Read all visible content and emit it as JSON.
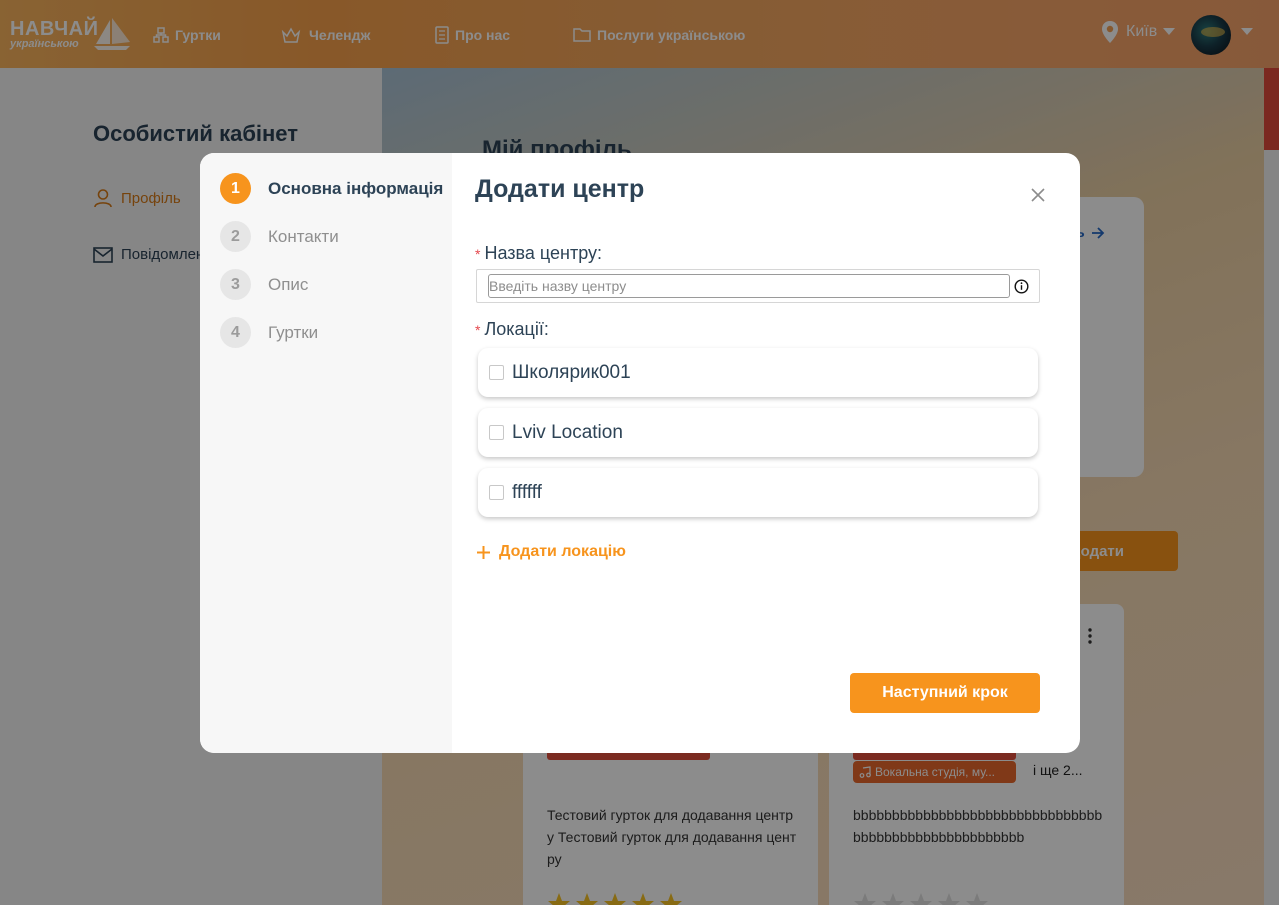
{
  "header": {
    "logo_main": "НАВЧАЙ",
    "logo_sub": "українською",
    "nav": [
      {
        "label": "Гуртки",
        "icon": "clubs-icon"
      },
      {
        "label": "Челендж",
        "icon": "challenge-icon"
      },
      {
        "label": "Про нас",
        "icon": "about-icon"
      },
      {
        "label": "Послуги українською",
        "icon": "folder-icon"
      }
    ],
    "city": "Київ"
  },
  "sidebar": {
    "title": "Особистий кабінет",
    "items": [
      {
        "label": "Профіль",
        "icon": "user-icon"
      },
      {
        "label": "Повідомлення",
        "icon": "mail-icon"
      }
    ]
  },
  "main": {
    "title": "Мій профіль",
    "profile_link": "ль",
    "add_button": "Додати",
    "clubs": [
      {
        "description": "Тестовий гурток для додавання центру Тестовий гурток для додавання центру",
        "rating": 5
      },
      {
        "tag": "Вокальна студія, му...",
        "more": "і ще 2...",
        "description": "bbbbbbbbbbbbbbbbbbbbbbbbbbbbbbbbbbbbbbbbbbbbbbbbbbbbbb",
        "rating": 0
      }
    ],
    "colors": {
      "accent": "#f7941d",
      "text": "#2d4356"
    }
  },
  "modal": {
    "title": "Додати центр",
    "steps": [
      {
        "num": "1",
        "label": "Основна інформація",
        "active": true
      },
      {
        "num": "2",
        "label": "Контакти",
        "active": false
      },
      {
        "num": "3",
        "label": "Опис",
        "active": false
      },
      {
        "num": "4",
        "label": "Гуртки",
        "active": false
      }
    ],
    "name_field": {
      "required_mark": "*",
      "label": "Назва центру:",
      "value": "",
      "placeholder": "Введіть назву центру"
    },
    "locations_field": {
      "required_mark": "*",
      "label": "Локації:",
      "options": [
        {
          "label": "Школярик001",
          "checked": false
        },
        {
          "label": "Lviv Location",
          "checked": false
        },
        {
          "label": "ffffff",
          "checked": false
        }
      ]
    },
    "add_location": "Додати локацію",
    "next_button": "Наступний крок"
  }
}
